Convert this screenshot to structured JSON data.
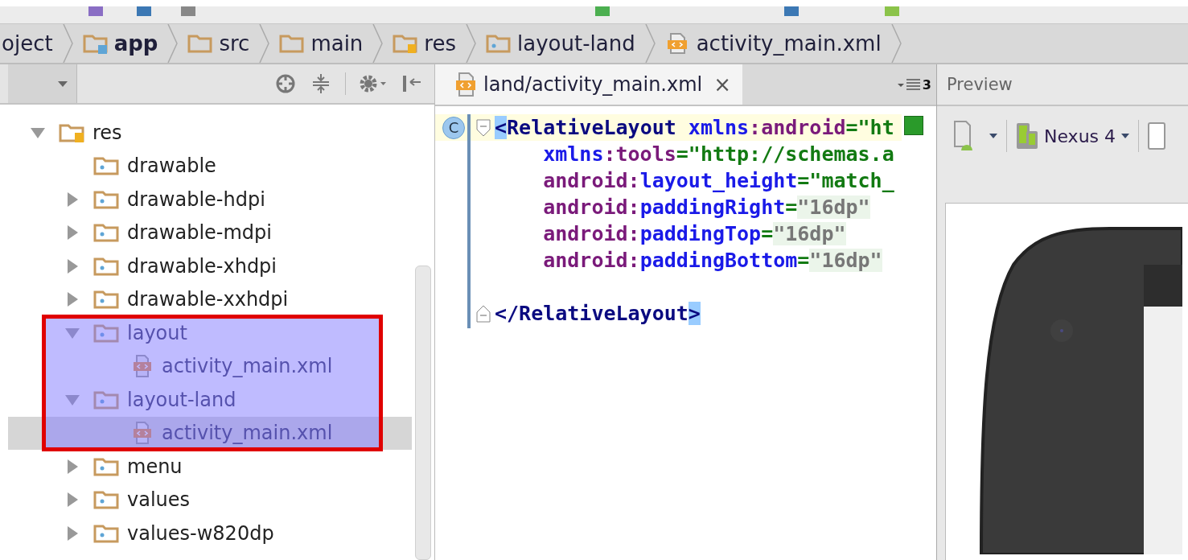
{
  "breadcrumbs": [
    {
      "label": "oject",
      "kind": "project"
    },
    {
      "label": "app",
      "kind": "module"
    },
    {
      "label": "src",
      "kind": "folder"
    },
    {
      "label": "main",
      "kind": "folder"
    },
    {
      "label": "res",
      "kind": "res"
    },
    {
      "label": "layout-land",
      "kind": "res-folder"
    },
    {
      "label": "activity_main.xml",
      "kind": "xml"
    }
  ],
  "project_panel": {
    "tree": [
      {
        "label": "res",
        "kind": "res",
        "expandable": true,
        "expanded": true,
        "selected": false,
        "highlighted": false,
        "children": [
          {
            "label": "drawable",
            "kind": "folder",
            "expandable": false,
            "selected": false,
            "highlighted": false
          },
          {
            "label": "drawable-hdpi",
            "kind": "folder",
            "expandable": true,
            "expanded": false,
            "selected": false,
            "highlighted": false
          },
          {
            "label": "drawable-mdpi",
            "kind": "folder",
            "expandable": true,
            "expanded": false,
            "selected": false,
            "highlighted": false
          },
          {
            "label": "drawable-xhdpi",
            "kind": "folder",
            "expandable": true,
            "expanded": false,
            "selected": false,
            "highlighted": false
          },
          {
            "label": "drawable-xxhdpi",
            "kind": "folder",
            "expandable": true,
            "expanded": false,
            "selected": false,
            "highlighted": false
          },
          {
            "label": "layout",
            "kind": "folder",
            "expandable": true,
            "expanded": true,
            "selected": false,
            "highlighted": true,
            "children": [
              {
                "label": "activity_main.xml",
                "kind": "xml",
                "selected": false,
                "highlighted": true
              }
            ]
          },
          {
            "label": "layout-land",
            "kind": "folder",
            "expandable": true,
            "expanded": true,
            "selected": false,
            "highlighted": true,
            "children": [
              {
                "label": "activity_main.xml",
                "kind": "xml",
                "selected": true,
                "highlighted": true
              }
            ]
          },
          {
            "label": "menu",
            "kind": "folder",
            "expandable": true,
            "expanded": false,
            "selected": false,
            "highlighted": false
          },
          {
            "label": "values",
            "kind": "folder",
            "expandable": true,
            "expanded": false,
            "selected": false,
            "highlighted": false
          },
          {
            "label": "values-w820dp",
            "kind": "folder",
            "expandable": true,
            "expanded": false,
            "selected": false,
            "highlighted": false
          }
        ]
      }
    ]
  },
  "editor": {
    "tabs": [
      {
        "label": "land/activity_main.xml",
        "close": "×",
        "selected": true
      }
    ],
    "tab_count": "3",
    "lines": [
      {
        "current": true,
        "kind": "fold-start",
        "indented": false,
        "gutter_mark": "C",
        "segments": [
          {
            "text": "<",
            "kind": "match"
          },
          {
            "text": "RelativeLayout",
            "kind": "tag"
          },
          {
            "text": "xmlns",
            "kind": "attr",
            "gap": true
          },
          {
            "text": ":android",
            "kind": "ns"
          },
          {
            "text": "=\"ht",
            "kind": "value"
          }
        ]
      },
      {
        "current": false,
        "kind": "plain",
        "indented": true,
        "segments": [
          {
            "text": "xmlns",
            "kind": "attr"
          },
          {
            "text": ":tools",
            "kind": "ns"
          },
          {
            "text": "=\"http://schemas.a",
            "kind": "value"
          }
        ]
      },
      {
        "current": false,
        "kind": "plain",
        "indented": true,
        "segments": [
          {
            "text": "android:",
            "kind": "ns"
          },
          {
            "text": "layout_height",
            "kind": "attr"
          },
          {
            "text": "=\"match_",
            "kind": "value"
          }
        ]
      },
      {
        "current": false,
        "kind": "plain",
        "indented": true,
        "segments": [
          {
            "text": "android:",
            "kind": "ns"
          },
          {
            "text": "paddingRight",
            "kind": "attr"
          },
          {
            "text": "=",
            "kind": "value"
          },
          {
            "text": "\"16dp\"",
            "kind": "folded"
          }
        ]
      },
      {
        "current": false,
        "kind": "plain",
        "indented": true,
        "segments": [
          {
            "text": "android:",
            "kind": "ns"
          },
          {
            "text": "paddingTop",
            "kind": "attr"
          },
          {
            "text": "=",
            "kind": "value"
          },
          {
            "text": "\"16dp\"",
            "kind": "folded"
          }
        ]
      },
      {
        "current": false,
        "kind": "plain",
        "indented": true,
        "segments": [
          {
            "text": "android:",
            "kind": "ns"
          },
          {
            "text": "paddingBottom",
            "kind": "attr"
          },
          {
            "text": "=",
            "kind": "value"
          },
          {
            "text": "\"16dp\"",
            "kind": "folded"
          }
        ]
      },
      {
        "current": false,
        "kind": "plain"
      },
      {
        "current": false,
        "kind": "fold-end",
        "indented": false,
        "segments": [
          {
            "text": "</",
            "kind": "punct"
          },
          {
            "text": "RelativeLayout",
            "kind": "tag"
          },
          {
            "text": ">",
            "kind": "match"
          }
        ]
      }
    ]
  },
  "preview": {
    "title": "Preview",
    "device": "Nexus 4"
  }
}
